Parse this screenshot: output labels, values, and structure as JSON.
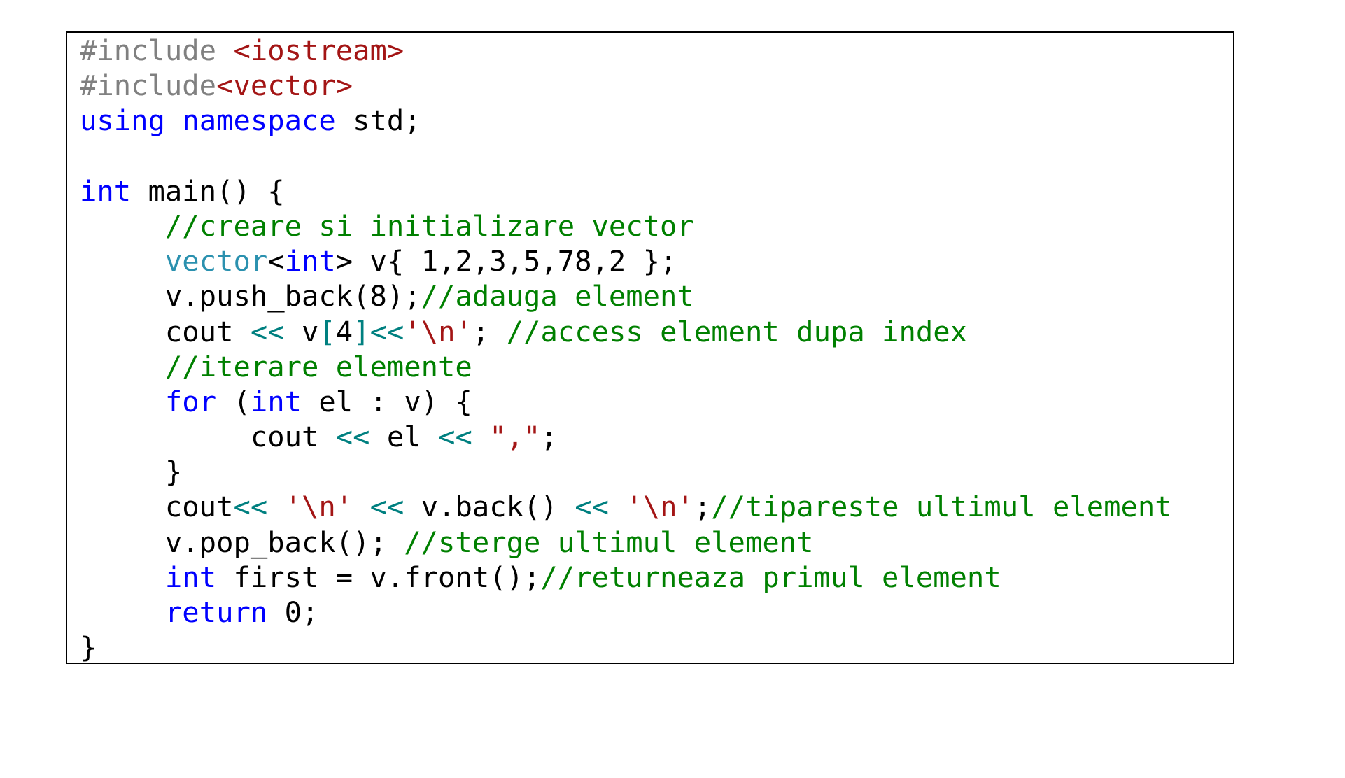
{
  "code_lines": [
    [
      {
        "t": "#include ",
        "c": "preproc"
      },
      {
        "t": "<iostream>",
        "c": "include"
      }
    ],
    [
      {
        "t": "#include",
        "c": "preproc"
      },
      {
        "t": "<vector>",
        "c": "include"
      }
    ],
    [
      {
        "t": "using",
        "c": "keyword"
      },
      {
        "t": " ",
        "c": "plain"
      },
      {
        "t": "namespace",
        "c": "keyword"
      },
      {
        "t": " std;",
        "c": "plain"
      }
    ],
    [],
    [
      {
        "t": "int",
        "c": "keyword"
      },
      {
        "t": " main() {",
        "c": "plain"
      }
    ],
    [
      {
        "t": "     ",
        "c": "plain"
      },
      {
        "t": "//creare si initializare vector",
        "c": "comment"
      }
    ],
    [
      {
        "t": "     ",
        "c": "plain"
      },
      {
        "t": "vector",
        "c": "type"
      },
      {
        "t": "<",
        "c": "plain"
      },
      {
        "t": "int",
        "c": "keyword"
      },
      {
        "t": "> v{ 1,2,3,5,78,2 };",
        "c": "plain"
      }
    ],
    [
      {
        "t": "     v.push_back(8);",
        "c": "plain"
      },
      {
        "t": "//adauga element",
        "c": "comment"
      }
    ],
    [
      {
        "t": "     cout ",
        "c": "plain"
      },
      {
        "t": "<<",
        "c": "operator"
      },
      {
        "t": " v",
        "c": "plain"
      },
      {
        "t": "[",
        "c": "operator"
      },
      {
        "t": "4",
        "c": "plain"
      },
      {
        "t": "]<<",
        "c": "operator"
      },
      {
        "t": "'\\n'",
        "c": "string"
      },
      {
        "t": "; ",
        "c": "plain"
      },
      {
        "t": "//access element dupa index",
        "c": "comment"
      }
    ],
    [
      {
        "t": "     ",
        "c": "plain"
      },
      {
        "t": "//iterare elemente",
        "c": "comment"
      }
    ],
    [
      {
        "t": "     ",
        "c": "plain"
      },
      {
        "t": "for",
        "c": "keyword"
      },
      {
        "t": " (",
        "c": "plain"
      },
      {
        "t": "int",
        "c": "keyword"
      },
      {
        "t": " el : v) {",
        "c": "plain"
      }
    ],
    [
      {
        "t": "          cout ",
        "c": "plain"
      },
      {
        "t": "<<",
        "c": "operator"
      },
      {
        "t": " el ",
        "c": "plain"
      },
      {
        "t": "<<",
        "c": "operator"
      },
      {
        "t": " ",
        "c": "plain"
      },
      {
        "t": "\",\"",
        "c": "string"
      },
      {
        "t": ";",
        "c": "plain"
      }
    ],
    [
      {
        "t": "     }",
        "c": "plain"
      }
    ],
    [
      {
        "t": "     cout",
        "c": "plain"
      },
      {
        "t": "<<",
        "c": "operator"
      },
      {
        "t": " ",
        "c": "plain"
      },
      {
        "t": "'\\n'",
        "c": "string"
      },
      {
        "t": " ",
        "c": "plain"
      },
      {
        "t": "<<",
        "c": "operator"
      },
      {
        "t": " v.back() ",
        "c": "plain"
      },
      {
        "t": "<<",
        "c": "operator"
      },
      {
        "t": " ",
        "c": "plain"
      },
      {
        "t": "'\\n'",
        "c": "string"
      },
      {
        "t": ";",
        "c": "plain"
      },
      {
        "t": "//tipareste ultimul element",
        "c": "comment"
      }
    ],
    [
      {
        "t": "     v.pop_back(); ",
        "c": "plain"
      },
      {
        "t": "//sterge ultimul element",
        "c": "comment"
      }
    ],
    [
      {
        "t": "     ",
        "c": "plain"
      },
      {
        "t": "int",
        "c": "keyword"
      },
      {
        "t": " first = v.front();",
        "c": "plain"
      },
      {
        "t": "//returneaza primul element",
        "c": "comment"
      }
    ],
    [
      {
        "t": "     ",
        "c": "plain"
      },
      {
        "t": "return",
        "c": "keyword"
      },
      {
        "t": " 0;",
        "c": "plain"
      }
    ],
    [
      {
        "t": "}",
        "c": "plain"
      }
    ]
  ],
  "colors": {
    "preproc": "#808080",
    "include": "#a31515",
    "keyword": "#0000ff",
    "type": "#2b91af",
    "comment": "#008000",
    "string": "#a31515",
    "operator": "#008080",
    "plain": "#000000"
  }
}
